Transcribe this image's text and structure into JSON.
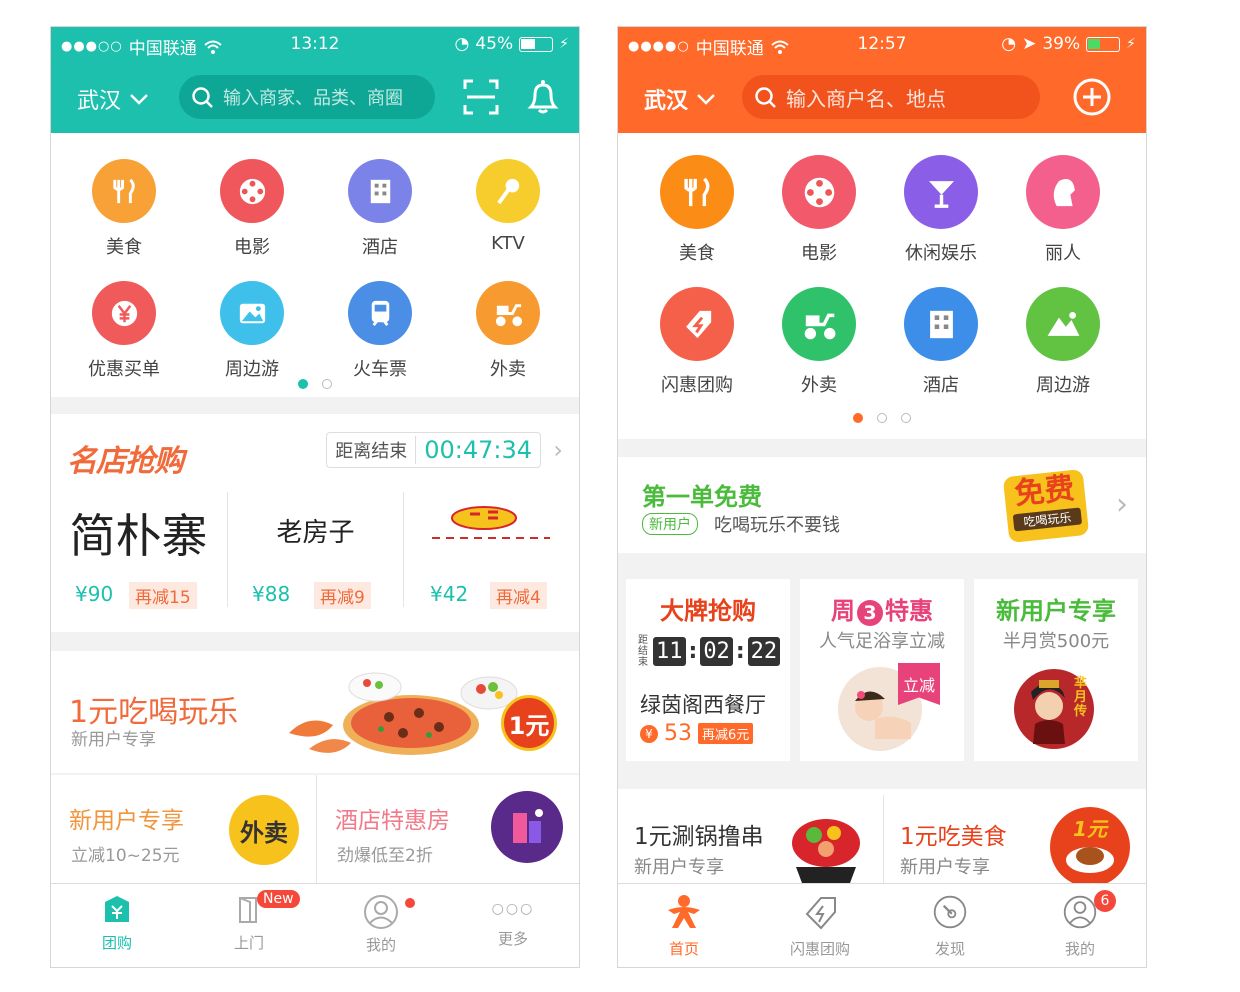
{
  "phoneA": {
    "status": {
      "carrier": "中国联通",
      "time": "13:12",
      "battery": "45%",
      "battery_level": 0.45
    },
    "header": {
      "city": "武汉",
      "search_placeholder": "输入商家、品类、商圈"
    },
    "categories": [
      {
        "label": "美食",
        "icon": "fork-knife-icon",
        "color": "#f7a136"
      },
      {
        "label": "电影",
        "icon": "film-reel-icon",
        "color": "#f0575c"
      },
      {
        "label": "酒店",
        "icon": "hotel-building-icon",
        "color": "#7c83e8"
      },
      {
        "label": "KTV",
        "icon": "microphone-icon",
        "color": "#f6cd2c"
      },
      {
        "label": "优惠买单",
        "icon": "yen-icon",
        "color": "#f05a5a"
      },
      {
        "label": "周边游",
        "icon": "landscape-icon",
        "color": "#3ec0ea"
      },
      {
        "label": "火车票",
        "icon": "train-icon",
        "color": "#4a8ee6"
      },
      {
        "label": "外卖",
        "icon": "scooter-icon",
        "color": "#f79a30"
      }
    ],
    "pager": {
      "count": 2,
      "active": 1,
      "active_color": "#1cc0ad"
    },
    "flash": {
      "title": "名店抢购",
      "countdown_label": "距离结束",
      "countdown": "00:47:34",
      "shops": [
        {
          "name": "简朴寨",
          "price": "¥90",
          "off": "再减15"
        },
        {
          "name": "老房子",
          "price": "¥88",
          "off": "再减9"
        },
        {
          "name": "",
          "price": "¥42",
          "off": "再减4"
        }
      ]
    },
    "promo": {
      "title": "1元吃喝玩乐",
      "subtitle": "新用户专享",
      "badge": "1元"
    },
    "cards": [
      {
        "title": "新用户专享",
        "subtitle": "立减10~25元",
        "badge": "外卖"
      },
      {
        "title": "酒店特惠房",
        "subtitle": "劲爆低至2折"
      }
    ],
    "tabs": [
      {
        "label": "团购",
        "icon": "tuangou-icon",
        "active": true
      },
      {
        "label": "上门",
        "icon": "door-icon",
        "badge": "New"
      },
      {
        "label": "我的",
        "icon": "user-icon",
        "dot": true
      },
      {
        "label": "更多",
        "icon": "more-icon"
      }
    ]
  },
  "phoneB": {
    "status": {
      "carrier": "中国联通",
      "time": "12:57",
      "battery": "39%",
      "battery_level": 0.39
    },
    "header": {
      "city": "武汉",
      "search_placeholder": "输入商户名、地点"
    },
    "categories": [
      {
        "label": "美食",
        "icon": "fork-knife-icon",
        "color": "#fb8c15"
      },
      {
        "label": "电影",
        "icon": "film-reel-icon",
        "color": "#f2596a"
      },
      {
        "label": "休闲娱乐",
        "icon": "cocktail-icon",
        "color": "#8a5ee6"
      },
      {
        "label": "丽人",
        "icon": "woman-profile-icon",
        "color": "#f4608e"
      },
      {
        "label": "闪惠团购",
        "icon": "lightning-tag-icon",
        "color": "#f5604a"
      },
      {
        "label": "外卖",
        "icon": "scooter-icon",
        "color": "#2fc26b"
      },
      {
        "label": "酒店",
        "icon": "hotel-building-icon",
        "color": "#3d8ee8"
      },
      {
        "label": "周边游",
        "icon": "mountain-icon",
        "color": "#62c342"
      }
    ],
    "pager": {
      "count": 3,
      "active": 1,
      "active_color": "#ff6a2a"
    },
    "freebie": {
      "title": "第一单免费",
      "tag": "新用户",
      "subtitle": "吃喝玩乐不要钱",
      "art_big": "免费",
      "art_small": "吃喝玩乐"
    },
    "tiles": [
      {
        "title": "大牌抢购",
        "countdown_label": "距结束",
        "hh": "11",
        "mm": "02",
        "ss": "22",
        "shop": "绿茵阁西餐厅",
        "price": "53",
        "off": "再减6元"
      },
      {
        "title": "周3特惠",
        "title_pre": "周",
        "title_num": "3",
        "title_post": "特惠",
        "subtitle": "人气足浴享立减",
        "tag": "立减"
      },
      {
        "title": "新用户专享",
        "subtitle": "半月赏500元",
        "art": "芈月传"
      }
    ],
    "bottom_cards": [
      {
        "title": "1元涮锅撸串",
        "subtitle": "新用户专享"
      },
      {
        "title": "1元吃美食",
        "subtitle": "新用户专享",
        "badge": "1元"
      }
    ],
    "tabs": [
      {
        "label": "首页",
        "icon": "home-person-icon",
        "active": true
      },
      {
        "label": "闪惠团购",
        "icon": "lightning-tag-icon"
      },
      {
        "label": "发现",
        "icon": "compass-icon"
      },
      {
        "label": "我的",
        "icon": "user-icon",
        "badge": "6"
      }
    ]
  }
}
